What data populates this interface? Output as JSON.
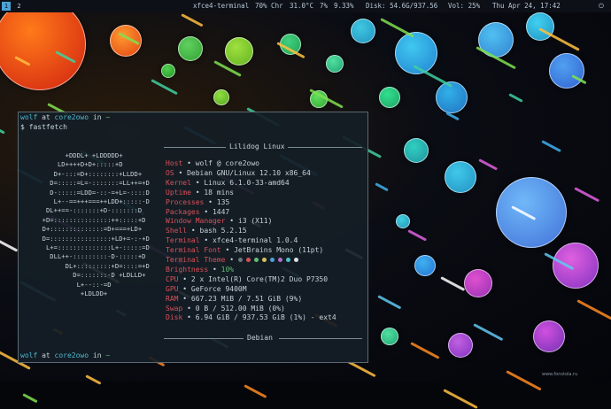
{
  "topbar": {
    "workspaces": [
      "1",
      "2"
    ],
    "active_window": "xfce4-terminal",
    "cpu": "70% Chr",
    "temp": "31.0°C",
    "mem": "7%",
    "load": "9.33%",
    "disk": "Disk: 54.6G/937.56",
    "volume": "Vol: 25%",
    "datetime": "Thu Apr 24, 17:42"
  },
  "terminal": {
    "prompt1": {
      "user": "wolf",
      "at": " at ",
      "host": "core2owo",
      "in": " in ",
      "dir": "~"
    },
    "command": "$ fastfetch",
    "header_title": "Lilidog Linux",
    "footer_title": "Debian",
    "logo_lines": [
      "        +DDDL+ +LDDDDD+",
      "      LD++++D+D+:::::+D",
      "     D+-:::=D+::::::::+LLDD+",
      "    D=:::::=L=-:::::::=LL++=+D",
      "    D-:::::=LDD=-::-=+L=-::::D",
      "     L+--==+++===++LDD+:::::-D",
      "   DL++==-:::::::+D-:::::::D",
      "  +D=:::::::::::::::++:::::+D",
      "  D+::::::::::::::=D+===+LD+",
      "  D=::::::::::::::::+LD+=-:-+D",
      "   L+=::::::::::::::L+-:::::=D",
      "    DLL++-:::::::::-D-:::::+D",
      "        DL+:::::::::+D=::::=+D",
      "          D=:::::::-D +LDLLD+",
      "           L+--::-=D",
      "            +LDLDD+"
    ],
    "info": [
      {
        "key": "Host",
        "value": "wolf @ core2owo"
      },
      {
        "key": "OS",
        "value": "Debian GNU/Linux 12.10 x86_64"
      },
      {
        "key": "Kernel",
        "value": "Linux 6.1.0-33-amd64"
      },
      {
        "key": "Uptime",
        "value": "18 mins"
      },
      {
        "key": "Processes",
        "value": "135"
      },
      {
        "key": "Packages",
        "value": "1447"
      },
      {
        "key": "Window Manager",
        "value": "i3 (X11)"
      },
      {
        "key": "Shell",
        "value": "bash 5.2.15"
      },
      {
        "key": "Terminal",
        "value": "xfce4-terminal 1.0.4"
      },
      {
        "key": "Terminal Font",
        "value": "JetBrains Mono (11pt)"
      },
      {
        "key": "Terminal Theme",
        "value": ""
      },
      {
        "key": "Brightness",
        "value": "10%"
      },
      {
        "key": "CPU",
        "value": "2 x Intel(R) Core(TM)2 Duo P7350"
      },
      {
        "key": "GPU",
        "value": "GeForce 9400M"
      },
      {
        "key": "RAM",
        "value": "667.23 MiB / 7.51 GiB (9%)"
      },
      {
        "key": "Swap",
        "value": "0 B / 512.00 MiB (0%)"
      },
      {
        "key": "Disk",
        "value": "6.94 GiB / 937.53 GiB (1%) - ext4"
      }
    ],
    "theme_colors": [
      "#6b7880",
      "#d7505a",
      "#5fbf76",
      "#d9c060",
      "#4fa0d8",
      "#b070c8",
      "#4fc0c8",
      "#d8e0e6"
    ],
    "prompt2": {
      "user": "wolf",
      "at": " at ",
      "host": "core2owo",
      "in": " in ",
      "dir": "~"
    }
  },
  "watermark": "www.fonstola.ru"
}
